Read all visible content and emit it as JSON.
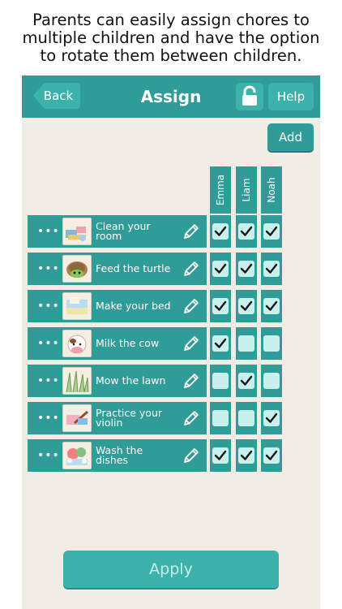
{
  "caption": {
    "line1": "Parents can easily assign chores to",
    "line2": "multiple children and have the option",
    "line3": "to rotate them between children."
  },
  "navbar": {
    "back_label": "Back",
    "title": "Assign",
    "help_label": "Help",
    "lock_icon": "lock-icon"
  },
  "add_label": "Add",
  "children": [
    "Emma",
    "Liam",
    "Noah"
  ],
  "chores": [
    {
      "label": "Clean your room",
      "icon": "messy-room-icon",
      "assigned": [
        true,
        true,
        true
      ]
    },
    {
      "label": "Feed the turtle",
      "icon": "turtle-icon",
      "assigned": [
        true,
        true,
        true
      ]
    },
    {
      "label": "Make your bed",
      "icon": "bed-icon",
      "assigned": [
        true,
        true,
        true
      ]
    },
    {
      "label": "Milk the cow",
      "icon": "cow-icon",
      "assigned": [
        true,
        false,
        false
      ]
    },
    {
      "label": "Mow the lawn",
      "icon": "grass-icon",
      "assigned": [
        false,
        true,
        false
      ]
    },
    {
      "label": "Practice your violin",
      "icon": "violin-icon",
      "assigned": [
        false,
        false,
        true
      ]
    },
    {
      "label": "Wash the dishes",
      "icon": "dishes-icon",
      "assigned": [
        true,
        true,
        true
      ]
    }
  ],
  "apply_label": "Apply",
  "colors": {
    "teal_dark": "#2f9c98",
    "teal_light": "#3db2ab",
    "check_bg": "#c8f0ec",
    "background": "#f2ede4"
  }
}
